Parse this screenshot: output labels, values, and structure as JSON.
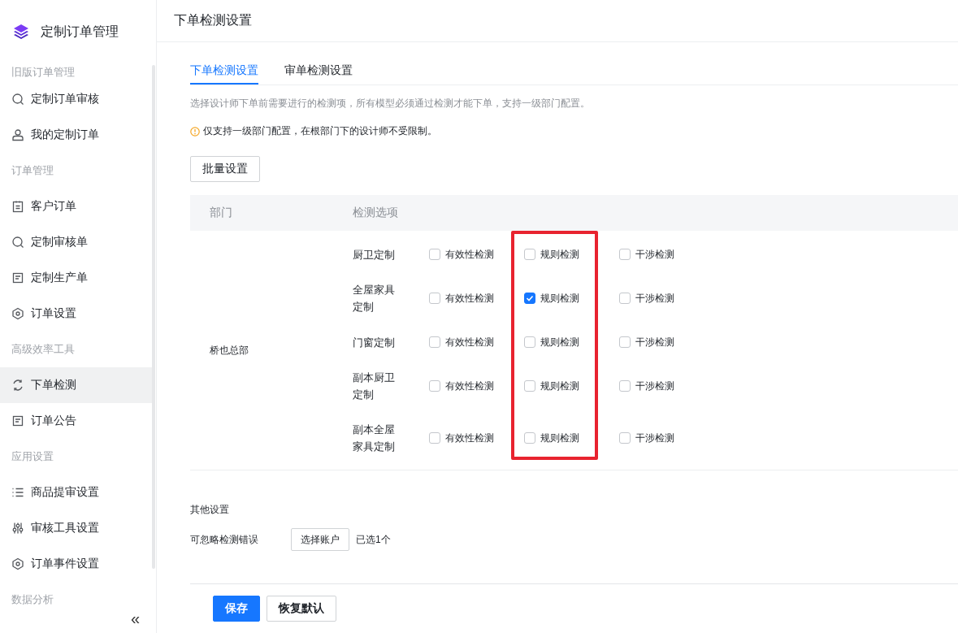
{
  "sidebar": {
    "title": "定制订单管理",
    "groups": [
      {
        "label": "旧版订单管理",
        "items": [
          {
            "label": "定制订单审核",
            "kind": "search",
            "selected": false
          },
          {
            "label": "我的定制订单",
            "kind": "user",
            "selected": false
          }
        ]
      },
      {
        "label": "订单管理",
        "items": [
          {
            "label": "客户订单",
            "kind": "clipboard",
            "selected": false
          },
          {
            "label": "定制审核单",
            "kind": "search",
            "selected": false
          },
          {
            "label": "定制生产单",
            "kind": "document",
            "selected": false
          },
          {
            "label": "订单设置",
            "kind": "hexagon",
            "selected": false
          }
        ]
      },
      {
        "label": "高级效率工具",
        "items": [
          {
            "label": "下单检测",
            "kind": "refresh",
            "selected": true
          },
          {
            "label": "订单公告",
            "kind": "document",
            "selected": false
          }
        ]
      },
      {
        "label": "应用设置",
        "items": [
          {
            "label": "商品提审设置",
            "kind": "list",
            "selected": false
          },
          {
            "label": "审核工具设置",
            "kind": "sliders",
            "selected": false
          },
          {
            "label": "订单事件设置",
            "kind": "hexagon",
            "selected": false
          }
        ]
      },
      {
        "label": "数据分析"
      }
    ],
    "collapse": "«"
  },
  "page_title": "下单检测设置",
  "tabs": [
    {
      "label": "下单检测设置",
      "selected": true
    },
    {
      "label": "审单检测设置",
      "selected": false
    }
  ],
  "description": "选择设计师下单前需要进行的检测项，所有模型必须通过检测才能下单，支持一级部门配置。",
  "warning": "仅支持一级部门配置，在根部门下的设计师不受限制。",
  "batch_button": "批量设置",
  "table": {
    "columns": [
      "部门",
      "检测选项"
    ],
    "option_columns": [
      {
        "highlighted": false
      },
      {
        "highlighted": true
      },
      {
        "highlighted": false
      }
    ],
    "department": "桥也总部",
    "rows": [
      {
        "name": "厨卫定制",
        "options": [
          {
            "label": "有效性检测",
            "checked": false
          },
          {
            "label": "规则检测",
            "checked": false
          },
          {
            "label": "干涉检测",
            "checked": false
          }
        ]
      },
      {
        "name": "全屋家具定制",
        "options": [
          {
            "label": "有效性检测",
            "checked": false
          },
          {
            "label": "规则检测",
            "checked": true
          },
          {
            "label": "干涉检测",
            "checked": false
          }
        ]
      },
      {
        "name": "门窗定制",
        "options": [
          {
            "label": "有效性检测",
            "checked": false
          },
          {
            "label": "规则检测",
            "checked": false
          },
          {
            "label": "干涉检测",
            "checked": false
          }
        ]
      },
      {
        "name": "副本厨卫定制",
        "options": [
          {
            "label": "有效性检测",
            "checked": false
          },
          {
            "label": "规则检测",
            "checked": false
          },
          {
            "label": "干涉检测",
            "checked": false
          }
        ]
      },
      {
        "name": "副本全屋家具定制",
        "options": [
          {
            "label": "有效性检测",
            "checked": false
          },
          {
            "label": "规则检测",
            "checked": false
          },
          {
            "label": "干涉检测",
            "checked": false
          }
        ]
      }
    ]
  },
  "other_settings": {
    "title": "其他设置",
    "label": "可忽略检测错误",
    "button": "选择账户",
    "status": "已选1个"
  },
  "footer": {
    "save": "保存",
    "reset": "恢复默认"
  }
}
